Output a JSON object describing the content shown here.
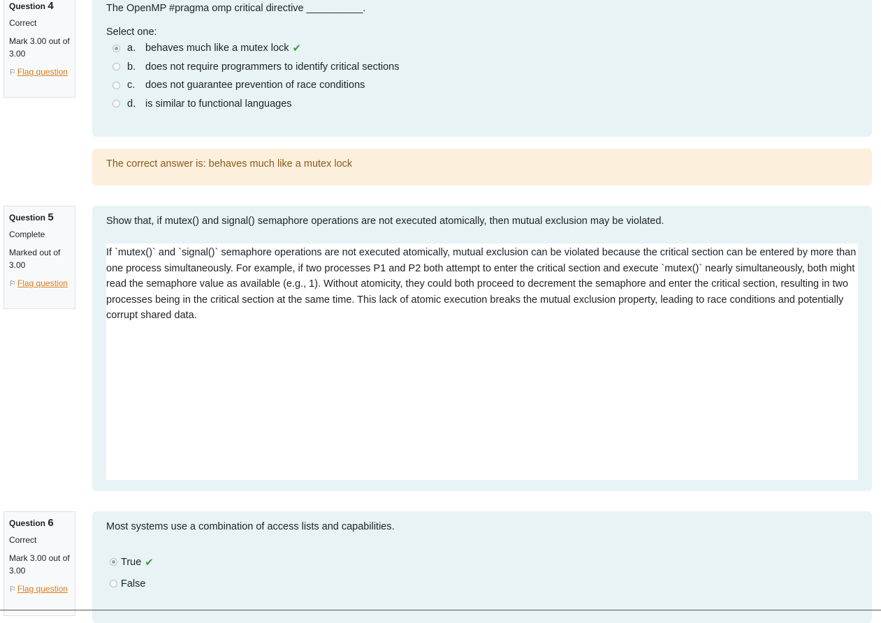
{
  "q4": {
    "label": "Question",
    "number": "4",
    "state": "Correct",
    "grade": "Mark 3.00 out of 3.00",
    "flag": "Flag question",
    "text": "The OpenMP #pragma omp critical directive __________.",
    "prompt": "Select one:",
    "options": [
      {
        "letter": "a.",
        "text": "behaves much like a mutex lock"
      },
      {
        "letter": "b.",
        "text": "does not require programmers to identify critical sections"
      },
      {
        "letter": "c.",
        "text": "does not guarantee prevention of race conditions"
      },
      {
        "letter": "d.",
        "text": "is similar to functional languages"
      }
    ],
    "feedback": "The correct answer is: behaves much like a mutex lock"
  },
  "q5": {
    "label": "Question",
    "number": "5",
    "state": "Complete",
    "grade": "Marked out of 3.00",
    "flag": "Flag question",
    "text": "Show that, if mutex() and signal() semaphore operations are not executed atomically, then mutual exclusion may be violated.",
    "answer": "If `mutex()` and `signal()` semaphore operations are not executed atomically, mutual exclusion can be violated because the critical section can be entered by more than one process simultaneously. For example, if two processes P1 and P2 both attempt to enter the critical section and execute `mutex()` nearly simultaneously, both might read the semaphore value as available (e.g., 1). Without atomicity, they could both proceed to decrement the semaphore and enter the critical section, resulting in two processes being in the critical section at the same time. This lack of atomic execution breaks the mutual exclusion property, leading to race conditions and potentially corrupt shared data."
  },
  "q6": {
    "label": "Question",
    "number": "6",
    "state": "Correct",
    "grade": "Mark 3.00 out of 3.00",
    "flag": "Flag question",
    "text": "Most systems use a combination of access lists and capabilities.",
    "options": [
      "True",
      "False"
    ]
  },
  "colors": {
    "formulation_bg": "#e7f3f5",
    "feedback_bg": "#fcefdc",
    "link": "#d97e1d",
    "tick": "#3f9b3f"
  }
}
